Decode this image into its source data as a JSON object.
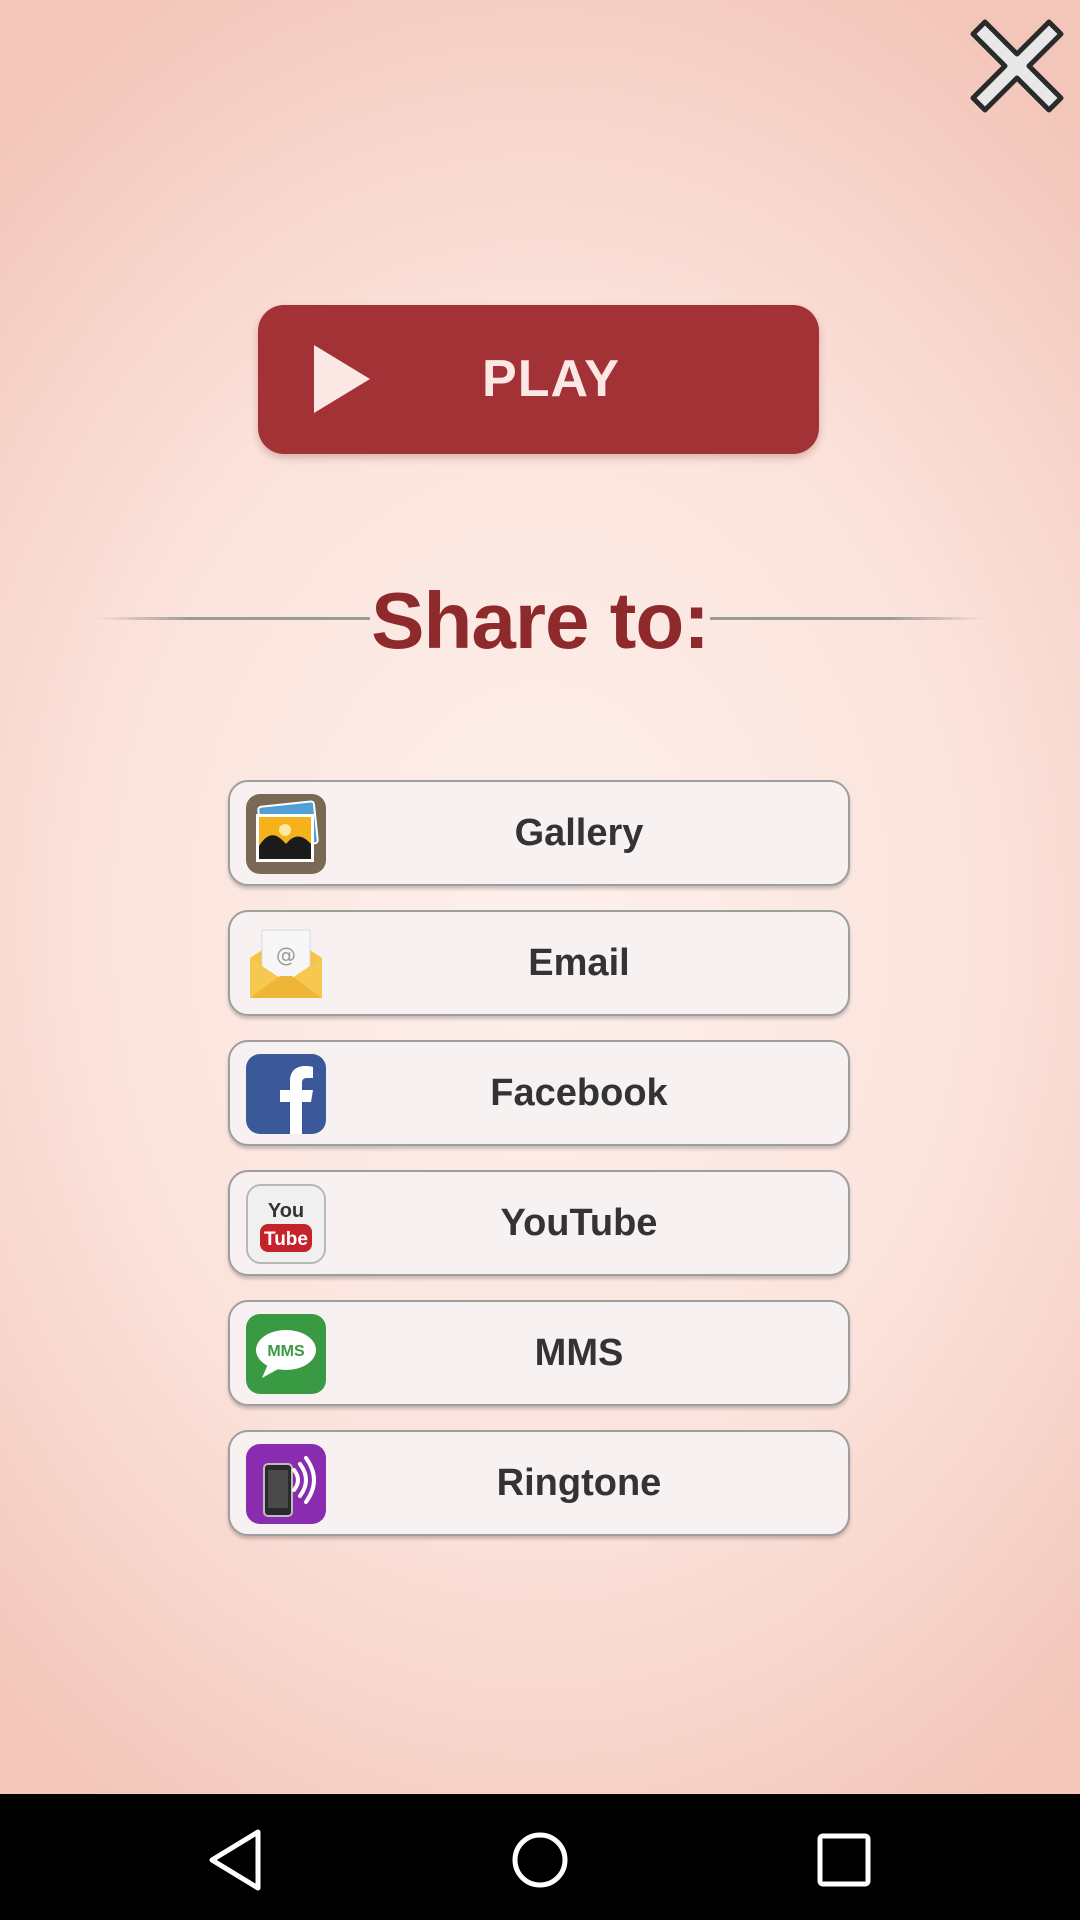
{
  "play_button": {
    "label": "PLAY"
  },
  "share_section": {
    "title": "Share to:"
  },
  "share_options": [
    {
      "label": "Gallery",
      "icon": "gallery-icon"
    },
    {
      "label": "Email",
      "icon": "email-envelope-icon"
    },
    {
      "label": "Facebook",
      "icon": "facebook-icon"
    },
    {
      "label": "YouTube",
      "icon": "youtube-icon",
      "icon_text_top": "You",
      "icon_text_bottom": "Tube"
    },
    {
      "label": "MMS",
      "icon": "mms-chat-icon",
      "icon_text": "MMS"
    },
    {
      "label": "Ringtone",
      "icon": "ringtone-phone-icon"
    }
  ],
  "colors": {
    "accent": "#a33236",
    "title": "#8f2a2c",
    "facebook": "#3b5998",
    "mms": "#3a9a44",
    "ringtone": "#8a2cb0"
  },
  "nav_bar": {
    "buttons": [
      "back-icon",
      "home-icon",
      "recents-icon"
    ]
  }
}
